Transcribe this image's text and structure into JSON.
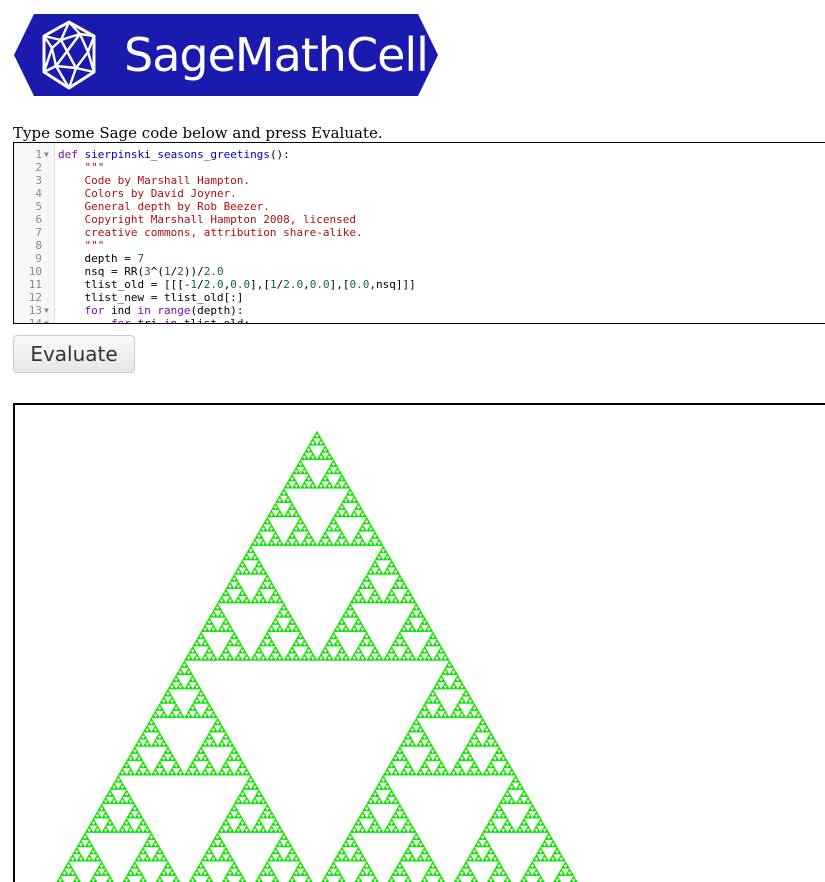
{
  "logo": {
    "text": "SageMathCell",
    "colors": {
      "background": "#1a1aae",
      "text": "#ffffff"
    },
    "icon": "polyhedron-icon"
  },
  "instructions": "Type some Sage code below and press Evaluate.",
  "editor": {
    "lines": [
      {
        "number": "1",
        "fold": true,
        "text": "def sierpinski_seasons_greetings():"
      },
      {
        "number": "2",
        "fold": false,
        "text": "    \"\"\""
      },
      {
        "number": "3",
        "fold": false,
        "text": "    Code by Marshall Hampton."
      },
      {
        "number": "4",
        "fold": false,
        "text": "    Colors by David Joyner."
      },
      {
        "number": "5",
        "fold": false,
        "text": "    General depth by Rob Beezer."
      },
      {
        "number": "6",
        "fold": false,
        "text": "    Copyright Marshall Hampton 2008, licensed"
      },
      {
        "number": "7",
        "fold": false,
        "text": "    creative commons, attribution share-alike."
      },
      {
        "number": "8",
        "fold": false,
        "text": "    \"\"\""
      },
      {
        "number": "9",
        "fold": false,
        "text": "    depth = 7"
      },
      {
        "number": "10",
        "fold": false,
        "text": "    nsq = RR(3^(1/2))/2.0"
      },
      {
        "number": "11",
        "fold": false,
        "text": "    tlist_old = [[[-1/2.0,0.0],[1/2.0,0.0],[0.0,nsq]]]"
      },
      {
        "number": "12",
        "fold": false,
        "text": "    tlist_new = tlist_old[:]"
      },
      {
        "number": "13",
        "fold": true,
        "text": "    for ind in range(depth):"
      },
      {
        "number": "14",
        "fold": true,
        "text": "        for tri in tlist_old:"
      }
    ],
    "colors": {
      "keyword": "#7a0ca6",
      "function": "#0000cc",
      "string": "#aa1111",
      "number": "#116644"
    }
  },
  "evaluate_button": {
    "label": "Evaluate"
  },
  "output": {
    "depth": 7,
    "colors": {
      "fill": "#00e600",
      "dots": "#c8c800",
      "background": "#ffffff"
    }
  }
}
